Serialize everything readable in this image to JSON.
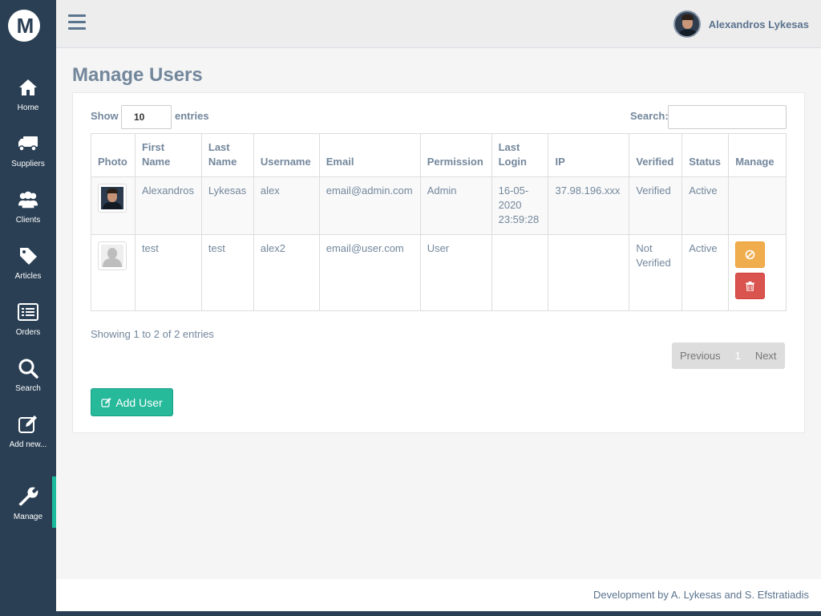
{
  "sidebar": {
    "logo": "M",
    "items": [
      {
        "label": "Home",
        "icon": "home-icon"
      },
      {
        "label": "Suppliers",
        "icon": "truck-icon"
      },
      {
        "label": "Clients",
        "icon": "users-icon"
      },
      {
        "label": "Articles",
        "icon": "tag-icon"
      },
      {
        "label": "Orders",
        "icon": "list-icon"
      },
      {
        "label": "Search",
        "icon": "search-icon"
      },
      {
        "label": "Add new...",
        "icon": "edit-icon"
      },
      {
        "label": "Manage",
        "icon": "wrench-icon",
        "active": true
      }
    ]
  },
  "header": {
    "user_name": "Alexandros Lykesas"
  },
  "page": {
    "title": "Manage Users"
  },
  "table_controls": {
    "show_label": "Show",
    "show_value": "10",
    "entries_label": "entries",
    "search_label": "Search:",
    "search_value": ""
  },
  "table": {
    "columns": [
      "Photo",
      "First Name",
      "Last Name",
      "Username",
      "Email",
      "Permission",
      "Last Login",
      "IP",
      "Verified",
      "Status",
      "Manage"
    ],
    "rows": [
      {
        "first": "Alexandros",
        "last": "Lykesas",
        "username": "alex",
        "email": "email@admin.com",
        "permission": "Admin",
        "last_login": "16-05-2020 23:59:28",
        "ip": "37.98.196.xxx",
        "verified": "Verified",
        "status": "Active"
      },
      {
        "first": "test",
        "last": "test",
        "username": "alex2",
        "email": "email@user.com",
        "permission": "User",
        "last_login": "",
        "ip": "",
        "verified": "Not Verified",
        "status": "Active"
      }
    ]
  },
  "pagination": {
    "info": "Showing 1 to 2 of 2 entries",
    "previous": "Previous",
    "current": "1",
    "next": "Next"
  },
  "actions": {
    "add_user": "Add User"
  },
  "footer": {
    "text": "Development by A. Lykesas and S. Efstratiadis"
  },
  "colors": {
    "sidebar": "#2a3f54",
    "accent": "#1abb9c",
    "add_button": "#26b99a",
    "warning": "#f0ad4e",
    "danger": "#d9534f"
  }
}
